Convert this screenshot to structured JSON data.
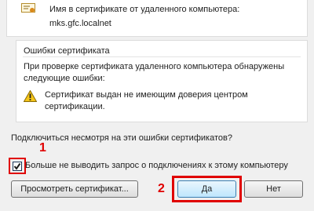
{
  "certificate_name": {
    "label": "Имя в сертификате от удаленного компьютера:",
    "value": "mks.gfc.localnet"
  },
  "errors_group": {
    "title": "Ошибки сертификата",
    "description": "При проверке сертификата удаленного компьютера обнаружены следующие ошибки:",
    "warning_text": "Сертификат выдан не имеющим доверия центром сертификации."
  },
  "question": "Подключиться несмотря на эти ошибки сертификатов?",
  "dont_ask_checkbox": {
    "label": "Больше не выводить запрос о подключениях к этому компьютеру",
    "checked": true
  },
  "buttons": {
    "view_certificate": "Просмотреть сертификат...",
    "yes": "Да",
    "no": "Нет"
  },
  "annotations": {
    "marker_1": "1",
    "marker_2": "2",
    "highlight_color": "#e00000"
  }
}
